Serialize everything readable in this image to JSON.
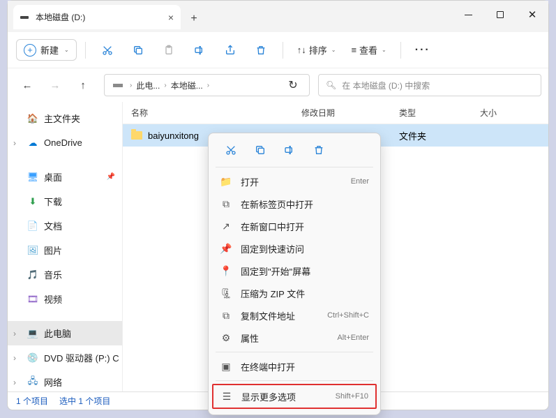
{
  "window": {
    "tab_title": "本地磁盘 (D:)"
  },
  "toolbar": {
    "new_label": "新建",
    "sort_label": "排序",
    "view_label": "查看"
  },
  "breadcrumbs": {
    "pc": "此电...",
    "drive": "本地磁..."
  },
  "search": {
    "placeholder": "在 本地磁盘 (D:) 中搜索"
  },
  "sidebar": {
    "home": "主文件夹",
    "onedrive": "OneDrive",
    "desktop": "桌面",
    "downloads": "下载",
    "documents": "文档",
    "pictures": "图片",
    "music": "音乐",
    "videos": "视频",
    "thispc": "此电脑",
    "dvd": "DVD 驱动器 (P:) C",
    "network": "网络"
  },
  "columns": {
    "name": "名称",
    "modified": "修改日期",
    "type": "类型",
    "size": "大小"
  },
  "row": {
    "name": "baiyunxitong",
    "type": "文件夹"
  },
  "context": {
    "open": "打开",
    "open_sc": "Enter",
    "newtab": "在新标签页中打开",
    "newwin": "在新窗口中打开",
    "pin_quick": "固定到快速访问",
    "pin_start": "固定到\"开始\"屏幕",
    "zip": "压缩为 ZIP 文件",
    "copypath": "复制文件地址",
    "copypath_sc": "Ctrl+Shift+C",
    "props": "属性",
    "props_sc": "Alt+Enter",
    "terminal": "在终端中打开",
    "more": "显示更多选项",
    "more_sc": "Shift+F10"
  },
  "status": {
    "count": "1 个项目",
    "selected": "选中 1 个项目"
  }
}
